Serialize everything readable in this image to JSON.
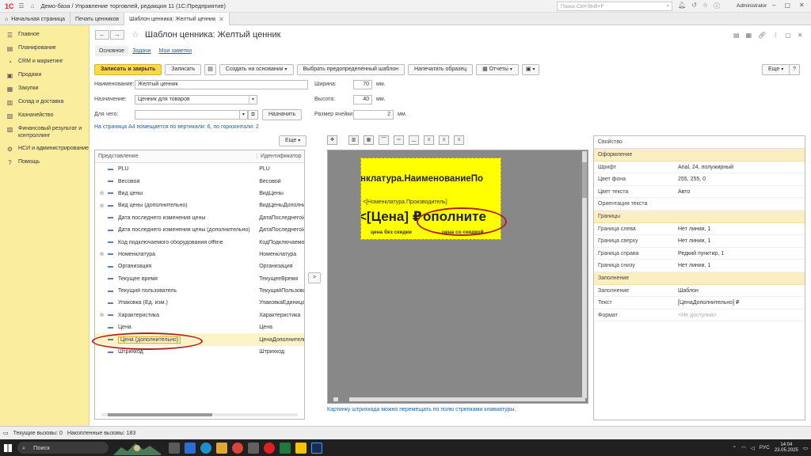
{
  "window": {
    "app_title": "Демо-база / Управление торговлей, редакция 11 (1С:Предприятие)",
    "search_placeholder": "Поиск Ctrl+Shift+F",
    "user": "Administrator"
  },
  "tabs": [
    {
      "label": "Начальная страница"
    },
    {
      "label": "Печать ценников"
    },
    {
      "label": "Шаблон ценника: Желтый ценник"
    }
  ],
  "sidebar": {
    "items": [
      {
        "label": "Главное",
        "icon": "menu-icon"
      },
      {
        "label": "Планирование",
        "icon": "planning-icon"
      },
      {
        "label": "CRM и маркетинг",
        "icon": "crm-icon"
      },
      {
        "label": "Продажи",
        "icon": "sales-icon"
      },
      {
        "label": "Закупки",
        "icon": "purchases-icon"
      },
      {
        "label": "Склад и доставка",
        "icon": "warehouse-icon"
      },
      {
        "label": "Казначейство",
        "icon": "treasury-icon"
      },
      {
        "label": "Финансовый результат и контроллинг",
        "icon": "finance-icon"
      },
      {
        "label": "НСИ и администрирование",
        "icon": "gear-icon"
      },
      {
        "label": "Помощь",
        "icon": "help-icon"
      }
    ]
  },
  "doc": {
    "title": "Шаблон ценника: Желтый ценник",
    "subtabs": [
      "Основное",
      "Задачи",
      "Мои заметки"
    ]
  },
  "toolbar": {
    "save_close": "Записать и закрыть",
    "save": "Записать",
    "create_based": "Создать на основании",
    "choose_template": "Выбрать предопределенный шаблон",
    "print_sample": "Напечатать образец",
    "reports": "Отчеты",
    "more": "Еще",
    "help": "?"
  },
  "form": {
    "name_label": "Наименование:",
    "name_value": "Желтый ценник",
    "purpose_label": "Назначение:",
    "purpose_value": "Ценник для товаров",
    "for_what_label": "Для чего:",
    "for_what_value": "",
    "assign_button": "Назначить",
    "width_label": "Ширина:",
    "width_value": "70",
    "width_unit": "мм.",
    "height_label": "Высота:",
    "height_value": "40",
    "height_unit": "мм.",
    "cell_label": "Размер ячейки:",
    "cell_value": "2",
    "cell_unit": "мм.",
    "info_link": "На страница А4 помещается по вертикали: 6, по горизонтали: 2",
    "tree_more": "Еще"
  },
  "tree": {
    "col1": "Представление",
    "col2": "Идентификатор",
    "rows": [
      {
        "name": "PLU",
        "id": "PLU",
        "expand": ""
      },
      {
        "name": "Весовой",
        "id": "Весовой",
        "expand": ""
      },
      {
        "name": "Вид цены",
        "id": "ВидЦены",
        "expand": "⊕"
      },
      {
        "name": "Вид цены (дополнительно)",
        "id": "ВидЦеныДополни",
        "expand": "⊕"
      },
      {
        "name": "Дата последнего изменения цены",
        "id": "ДатаПоследнегоИ",
        "expand": ""
      },
      {
        "name": "Дата последнего изменения цены (дополнительно)",
        "id": "ДатаПоследнегоИ",
        "expand": ""
      },
      {
        "name": "Код подключаемого оборудования offline",
        "id": "КодПодключаемо",
        "expand": ""
      },
      {
        "name": "Номенклатура",
        "id": "Номенклатура",
        "expand": "⊕"
      },
      {
        "name": "Организация",
        "id": "Организация",
        "expand": ""
      },
      {
        "name": "Текущее время",
        "id": "ТекущееВремя",
        "expand": ""
      },
      {
        "name": "Текущий пользователь",
        "id": "ТекущийПользова",
        "expand": ""
      },
      {
        "name": "Упаковка (Ед. изм.)",
        "id": "УпаковкаЕдиница",
        "expand": ""
      },
      {
        "name": "Характеристика",
        "id": "Характеристика",
        "expand": "⊕"
      },
      {
        "name": "Цена",
        "id": "Цена",
        "expand": ""
      },
      {
        "name": "Цена (дополнительно)",
        "id": "ЦенаДополнитель",
        "expand": ""
      },
      {
        "name": "Штрихкод",
        "id": "Штрихкод",
        "expand": ""
      }
    ]
  },
  "move_button": ">",
  "tag": {
    "line1": "нклатура.НаименованиеПо",
    "line2": "<[Номенклатура.Производитель]",
    "price": "<[Цена] ₽",
    "price_extra": "ополните",
    "caption1": "цена без скидки",
    "caption2": "цена со скидкой",
    "background": "#ffff00"
  },
  "canvas_hint": "Картинку штрихкода можно перемещать по полю стрелками клавиатуры.",
  "props": {
    "header": "Свойство",
    "groups": [
      {
        "title": "Оформление",
        "rows": [
          {
            "k": "Шрифт",
            "v": "Arial, 24, полужирный"
          },
          {
            "k": "Цвет фона",
            "v": "255, 255, 0"
          },
          {
            "k": "Цвет текста",
            "v": "Авто"
          },
          {
            "k": "Ориентация текста",
            "v": ""
          }
        ]
      },
      {
        "title": "Границы",
        "rows": [
          {
            "k": "Граница слева",
            "v": "Нет линии, 1"
          },
          {
            "k": "Граница сверху",
            "v": "Нет линии, 1"
          },
          {
            "k": "Граница справа",
            "v": "Редкий пунктир, 1"
          },
          {
            "k": "Граница снизу",
            "v": "Нет линии, 1"
          }
        ]
      },
      {
        "title": "Заполнение",
        "rows": [
          {
            "k": "Заполнение",
            "v": "Шаблон"
          },
          {
            "k": "Текст",
            "v": "[ЦенаДополнительно] ₽"
          },
          {
            "k": "Формат",
            "v": "<Не доступна>"
          }
        ]
      }
    ]
  },
  "status": {
    "current_calls": "Текущие вызовы: 0",
    "accum_calls": "Накопленные вызовы: 183"
  },
  "taskbar": {
    "search": "Поиск",
    "lang": "РУС",
    "time": "14:04",
    "date": "23.05.2025"
  },
  "colors": {
    "sidebar_bg": "#fbed9e",
    "primary_button": "#fbd94b",
    "highlight_ring": "#b02020",
    "link": "#1a5fb4"
  }
}
